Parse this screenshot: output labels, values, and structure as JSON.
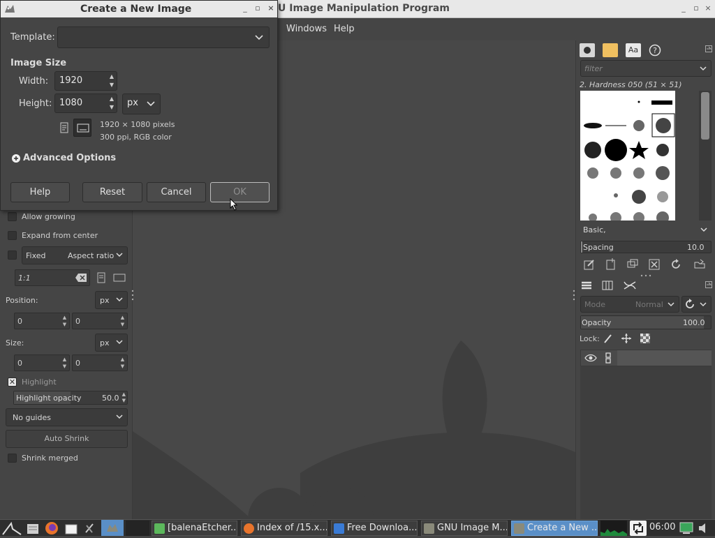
{
  "main_window": {
    "title": "U Image Manipulation Program",
    "controls": [
      "_",
      "▫",
      "×"
    ]
  },
  "menubar": {
    "items": [
      "Windows",
      "Help"
    ]
  },
  "dialog": {
    "title": "Create a New Image",
    "controls": [
      "_",
      "▫",
      "×"
    ],
    "template_label": "Template:",
    "template_value": "",
    "image_size_heading": "Image Size",
    "width_label": "Width:",
    "width_value": "1920",
    "height_label": "Height:",
    "height_value": "1080",
    "unit": "px",
    "info_pixels": "1920 × 1080 pixels",
    "info_ppi": "300 ppi, RGB color",
    "advanced_options": "Advanced Options",
    "buttons": {
      "help": "Help",
      "reset": "Reset",
      "cancel": "Cancel",
      "ok": "OK"
    }
  },
  "tool_options": {
    "allow_growing": "Allow growing",
    "expand_from_center": "Expand from center",
    "fixed_label": "Fixed",
    "aspect_ratio": "Aspect ratio",
    "ratio_value": "1:1",
    "position_label": "Position:",
    "position_unit": "px",
    "position_x": "0",
    "position_y": "0",
    "size_label": "Size:",
    "size_unit": "px",
    "size_x": "0",
    "size_y": "0",
    "highlight": "Highlight",
    "highlight_opacity_label": "Highlight opacity",
    "highlight_opacity_value": "50.0",
    "guides": "No guides",
    "auto_shrink": "Auto Shrink",
    "shrink_merged": "Shrink merged"
  },
  "brushes_panel": {
    "filter_placeholder": "filter",
    "selected_brush": "2. Hardness 050 (51 × 51)",
    "preset": "Basic,",
    "spacing_label": "Spacing",
    "spacing_value": "10.0"
  },
  "layers_panel": {
    "mode_label": "Mode",
    "mode_value": "Normal",
    "opacity_label": "Opacity",
    "opacity_value": "100.0",
    "lock_label": "Lock:"
  },
  "taskbar": {
    "tasks": [
      {
        "label": "[balenaEtcher...",
        "icon_color": "#5cb85c"
      },
      {
        "label": "Index of /15.x...",
        "icon_color": "#e8742c"
      },
      {
        "label": "Free Downloa...",
        "icon_color": "#3a7bd5"
      },
      {
        "label": "GNU Image M...",
        "icon_color": "#8a8a7a"
      },
      {
        "label": "Create a New ...",
        "icon_color": "#8a8a7a"
      }
    ],
    "clock": "06:00"
  }
}
